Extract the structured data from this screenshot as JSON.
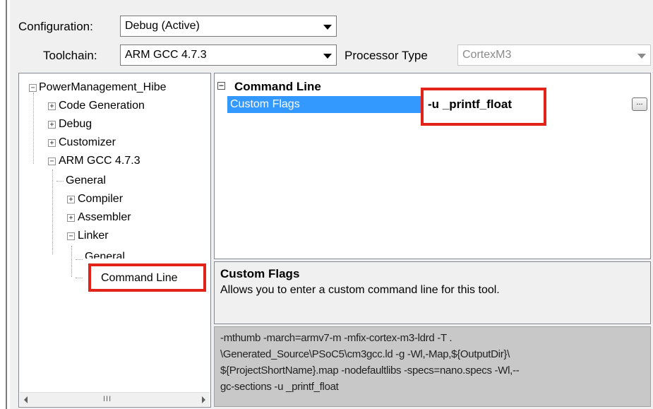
{
  "configuration": {
    "label": "Configuration:",
    "value": "Debug (Active)"
  },
  "toolchain": {
    "label": "Toolchain:",
    "value": "ARM GCC 4.7.3"
  },
  "processor_type": {
    "label": "Processor Type",
    "value": "CortexM3"
  },
  "tree": {
    "root": "PowerManagement_Hibe",
    "code_generation": "Code Generation",
    "debug": "Debug",
    "customizer": "Customizer",
    "arm_gcc": "ARM GCC 4.7.3",
    "general": "General",
    "compiler": "Compiler",
    "assembler": "Assembler",
    "linker": "Linker",
    "linker_general": "General",
    "command_line": "Command Line",
    "scroll_grip": "III"
  },
  "grid": {
    "category": "Command Line",
    "property_name": "Custom Flags",
    "property_value": "-u _printf_float",
    "ellipsis": "..."
  },
  "description": {
    "title": "Custom Flags",
    "text": "Allows you to enter a custom command line for this tool."
  },
  "command_preview": {
    "line1": "-mthumb -march=armv7-m -mfix-cortex-m3-ldrd -T .",
    "line2": "\\Generated_Source\\PSoC5\\cm3gcc.ld -g -Wl,-Map,${OutputDir}\\",
    "line3": "${ProjectShortName}.map -nodefaultlibs -specs=nano.specs -Wl,--",
    "line4": "gc-sections -u _printf_float"
  },
  "colors": {
    "selection": "#3399ff",
    "highlight": "#e2231a",
    "preview_bg": "#c8c8c8"
  }
}
